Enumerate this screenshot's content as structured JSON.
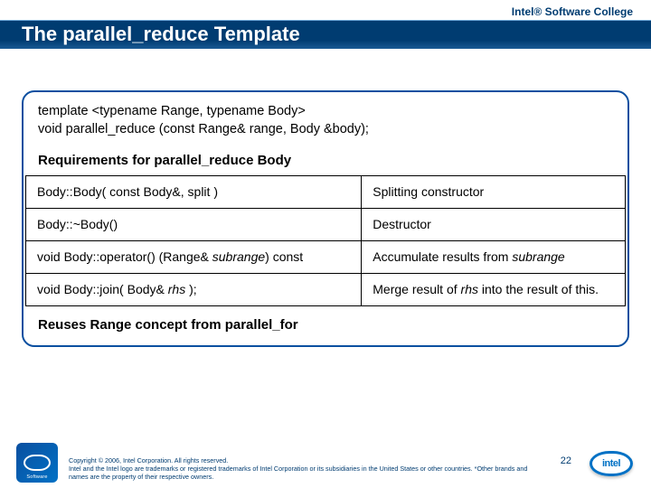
{
  "brand": "Intel® Software College",
  "title": "The parallel_reduce Template",
  "signature": {
    "line1": "template <typename Range, typename Body>",
    "line2": "void parallel_reduce (const Range& range, Body &body);"
  },
  "requirements_heading": "Requirements for parallel_reduce Body",
  "rows": [
    {
      "left": "Body::Body( const Body&, split )",
      "right": "Splitting constructor"
    },
    {
      "left": "Body::~Body()",
      "right": "Destructor"
    },
    {
      "left_pre": "void Body::operator() (Range& ",
      "left_em": "subrange",
      "left_post": ") const",
      "right_pre": "Accumulate results from ",
      "right_em": "subrange"
    },
    {
      "left_pre": "void Body::join( Body& ",
      "left_em": "rhs",
      "left_post": " );",
      "right_pre": "Merge result of ",
      "right_em": "rhs",
      "right_post": " into the result of this."
    }
  ],
  "reuses": "Reuses Range concept from parallel_for",
  "copyright": {
    "l1": "Copyright © 2006, Intel Corporation. All rights reserved.",
    "l2": "Intel and the Intel logo are trademarks or registered trademarks of Intel Corporation or its subsidiaries in the United States or other countries. *Other brands and names are the property of their respective owners."
  },
  "page": "22",
  "intel_text": "intel"
}
